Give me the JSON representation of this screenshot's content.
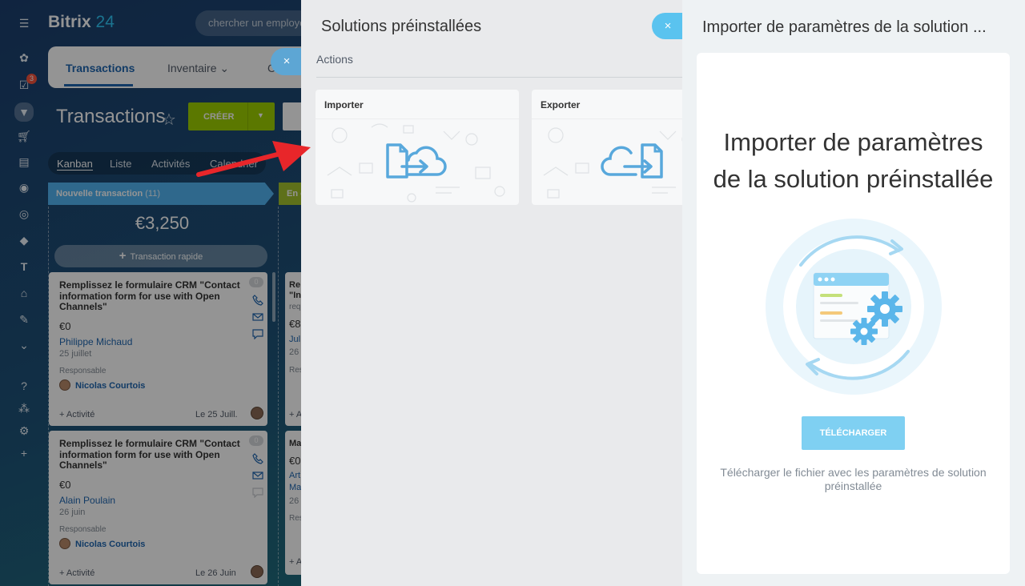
{
  "app": {
    "logo_brand": "Bitrix",
    "logo_num": "24",
    "search_placeholder": "chercher un employé",
    "notification_count": "3",
    "tabs": [
      {
        "label": "Transactions"
      },
      {
        "label": "Inventaire"
      },
      {
        "label": "C"
      }
    ],
    "page_title": "Transactions",
    "create_button": "CRÉER",
    "views": [
      "Kanban",
      "Liste",
      "Activités",
      "Calendrier"
    ],
    "stage": {
      "name": "Nouvelle transaction",
      "count": "(11)",
      "next_stage": "En c"
    },
    "column_sum": "€3,250",
    "quick_add": "Transaction rapide",
    "cards": [
      {
        "title": "Remplissez le formulaire CRM \"Contact information form for use with Open Channels\"",
        "amount": "€0",
        "client": "Philippe Michaud",
        "date": "25 juillet",
        "responsible_label": "Responsable",
        "responsible": "Nicolas Courtois",
        "activity": "+ Activité",
        "due": "Le 25 Juill.",
        "badge": "0"
      },
      {
        "title": "Remplissez le formulaire CRM \"Contact information form for use with Open Channels\"",
        "amount": "€0",
        "client": "Alain Poulain",
        "date": "26 juin",
        "responsible_label": "Responsable",
        "responsible": "Nicolas Courtois",
        "activity": "+ Activité",
        "due": "Le 26 Juin",
        "badge": "0"
      }
    ],
    "partial_cards": [
      {
        "line1": "Re",
        "line2": "\"In",
        "line3": "requ",
        "amount": "€8",
        "client": "Jul",
        "date": "26",
        "resp": "Res",
        "act": "+ A"
      },
      {
        "line1": "Ma",
        "amount": "€0",
        "client": "Art",
        "client2": "Ma",
        "date": "26",
        "resp": "Res",
        "act": "+ A"
      }
    ]
  },
  "middle_panel": {
    "title": "Solutions préinstallées",
    "close": "×",
    "section_label": "Actions",
    "tiles": [
      {
        "name": "Importer",
        "icon": "import-icon"
      },
      {
        "name": "Exporter",
        "icon": "export-icon"
      }
    ]
  },
  "right_panel": {
    "title": "Importer de paramètres de la solution ...",
    "heading_line1": "Importer de paramètres",
    "heading_line2": "de la solution préinstallée",
    "button": "TÉLÉCHARGER",
    "hint": "Télécharger le fichier avec les paramètres de solution préinstallée"
  },
  "colors": {
    "accent": "#2fc6f6",
    "create_green": "#9dcf00",
    "stage_blue": "#52b4f1",
    "button_light_blue": "#7fd0f2",
    "icon_blue": "#58a8dc",
    "arrow_red": "#e8262a"
  }
}
